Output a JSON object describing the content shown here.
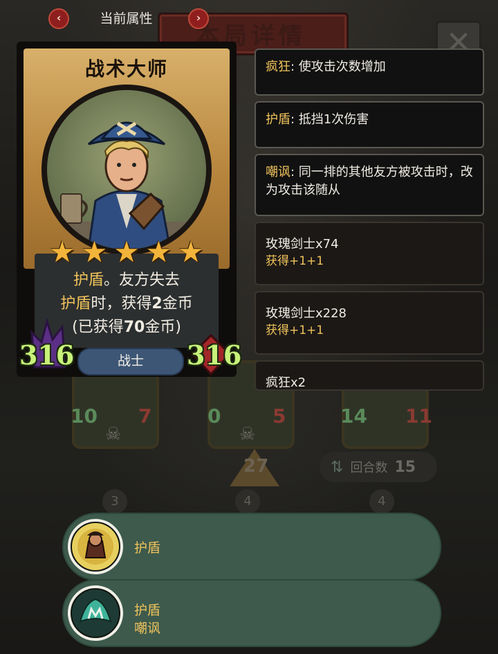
{
  "header": {
    "prev_icon": "chevron-left-icon",
    "next_icon": "chevron-right-icon",
    "prev_label": "‹",
    "next_label": "›",
    "title": "当前属性"
  },
  "background": {
    "panel_title": "本局详情",
    "close_label": "✕",
    "minions": [
      {
        "attack": "10",
        "health": "7"
      },
      {
        "attack": "0",
        "health": "5"
      },
      {
        "attack": "14",
        "health": "11"
      }
    ],
    "turn_value": "27",
    "round_label": "回合数",
    "round_value": "15",
    "tiers": [
      "3",
      "4",
      "4"
    ]
  },
  "card": {
    "name": "战术大师",
    "stars": 5,
    "description": {
      "line1_kw": "护盾",
      "line1_rest": "。友方失去",
      "line2_kw": "护盾",
      "line2_mid": "时，获得",
      "line2_num": "2",
      "line2_end": "金币",
      "line3_pre": "(已获得",
      "line3_num": "70",
      "line3_end": "金币)"
    },
    "attack": "316",
    "health": "316",
    "tribe": "战士"
  },
  "keywords": [
    {
      "name": "疯狂",
      "text": ": 使攻击次数增加"
    },
    {
      "name": "护盾",
      "text": ": 抵挡1次伤害"
    },
    {
      "name": "嘲讽",
      "text": ": 同一排的其他友方被攻击时，改为攻击该随从"
    }
  ],
  "buff_log": [
    {
      "source": "玫瑰剑士x74",
      "effect": "获得+1+1"
    },
    {
      "source": "玫瑰剑士x228",
      "effect": "获得+1+1"
    },
    {
      "source": "疯狂x2",
      "effect": ""
    }
  ],
  "effects_rows": [
    {
      "lines": [
        "护盾"
      ]
    },
    {
      "lines": [
        "护盾",
        "嘲讽"
      ]
    }
  ],
  "colors": {
    "keyword": "#f0c35b",
    "stat": "#c8f27a",
    "row_bg": "#3d5a4d",
    "tribe_bg": "#3d5675",
    "nav_btn": "#8f1f1f"
  }
}
